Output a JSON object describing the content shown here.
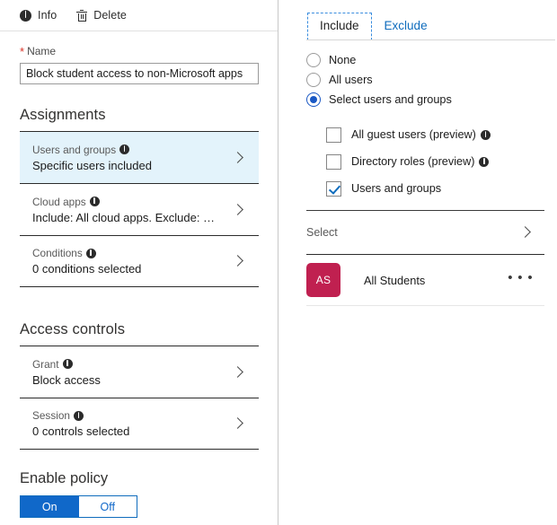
{
  "toolbar": {
    "info_label": "Info",
    "delete_label": "Delete",
    "info_icon": "info-circle-icon",
    "delete_icon": "trash-icon"
  },
  "name_field": {
    "required_marker": "*",
    "label": "Name",
    "value": "Block student access to non-Microsoft apps"
  },
  "assignments": {
    "heading": "Assignments",
    "rows": [
      {
        "title": "Users and groups",
        "subtitle": "Specific users included",
        "has_info_icon": true,
        "selected": true
      },
      {
        "title": "Cloud apps",
        "subtitle": "Include: All cloud apps. Exclude: …",
        "has_info_icon": true,
        "selected": false
      },
      {
        "title": "Conditions",
        "subtitle": "0 conditions selected",
        "has_info_icon": true,
        "selected": false
      }
    ]
  },
  "access_controls": {
    "heading": "Access controls",
    "rows": [
      {
        "title": "Grant",
        "subtitle": "Block access",
        "has_info_icon": true,
        "selected": false
      },
      {
        "title": "Session",
        "subtitle": "0 controls selected",
        "has_info_icon": true,
        "selected": false
      }
    ]
  },
  "enable_policy": {
    "label": "Enable policy",
    "on_label": "On",
    "off_label": "Off",
    "state": "On",
    "accent": "#1068c9"
  },
  "right_panel": {
    "tabs": [
      {
        "label": "Include",
        "active": true
      },
      {
        "label": "Exclude",
        "active": false
      }
    ],
    "radio_options": [
      {
        "label": "None",
        "checked": false
      },
      {
        "label": "All users",
        "checked": false
      },
      {
        "label": "Select users and groups",
        "checked": true
      }
    ],
    "checkbox_options": [
      {
        "label": "All guest users (preview)",
        "checked": false,
        "has_info_icon": true
      },
      {
        "label": "Directory roles (preview)",
        "checked": false,
        "has_info_icon": true
      },
      {
        "label": "Users and groups",
        "checked": true,
        "has_info_icon": false
      }
    ],
    "select_row": {
      "label": "Select"
    },
    "selected_groups": [
      {
        "initials": "AS",
        "name": "All Students",
        "avatar_color": "#c02050",
        "menu_glyph": "• • •"
      }
    ]
  }
}
